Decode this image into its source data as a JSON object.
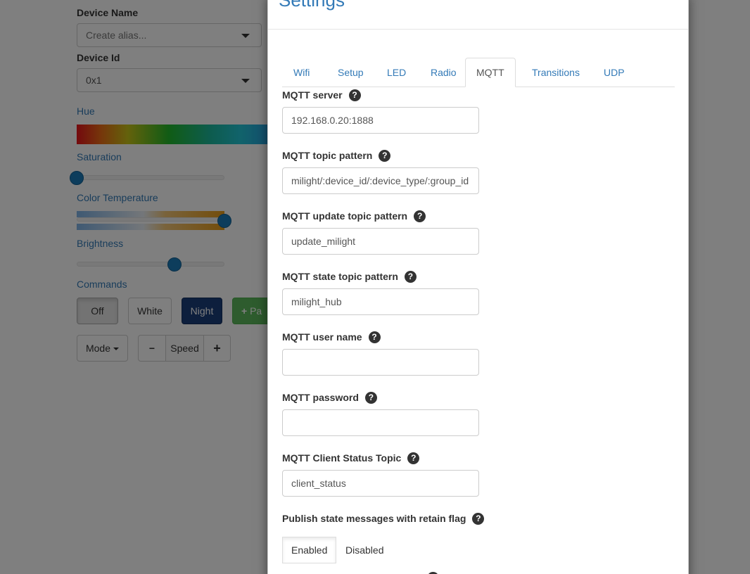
{
  "background": {
    "device_name_label": "Device Name",
    "device_name_placeholder": "Create alias...",
    "device_id_label": "Device Id",
    "device_id_value": "0x1",
    "hue_label": "Hue",
    "saturation_label": "Saturation",
    "saturation_value": 0.0,
    "color_temperature_label": "Color Temperature",
    "color_temperature_value": 1.0,
    "brightness_label": "Brightness",
    "brightness_value": 0.66,
    "commands_label": "Commands",
    "buttons": {
      "off": "Off",
      "white": "White",
      "night": "Night",
      "pair": "Pa",
      "mode": "Mode",
      "minus": "−",
      "speed": "Speed",
      "plus": "+"
    }
  },
  "modal": {
    "title": "Settings",
    "tabs": [
      {
        "label": "Wifi",
        "active": false
      },
      {
        "label": "Setup",
        "active": false
      },
      {
        "label": "LED",
        "active": false
      },
      {
        "label": "Radio",
        "active": false
      },
      {
        "label": "MQTT",
        "active": true
      },
      {
        "label": "Transitions",
        "active": false
      },
      {
        "label": "UDP",
        "active": false
      }
    ],
    "fields": [
      {
        "label": "MQTT server",
        "value": "192.168.0.20:1888"
      },
      {
        "label": "MQTT topic pattern",
        "value": "milight/:device_id/:device_type/:group_id"
      },
      {
        "label": "MQTT update topic pattern",
        "value": "update_milight"
      },
      {
        "label": "MQTT state topic pattern",
        "value": "milight_hub"
      },
      {
        "label": "MQTT user name",
        "value": ""
      },
      {
        "label": "MQTT password",
        "value": ""
      },
      {
        "label": "MQTT Client Status Topic",
        "value": "client_status"
      }
    ],
    "retain_flag": {
      "label": "Publish state messages with retain flag",
      "options": [
        "Enabled",
        "Disabled"
      ],
      "selected": "Enabled"
    },
    "help_glyph": "?"
  }
}
